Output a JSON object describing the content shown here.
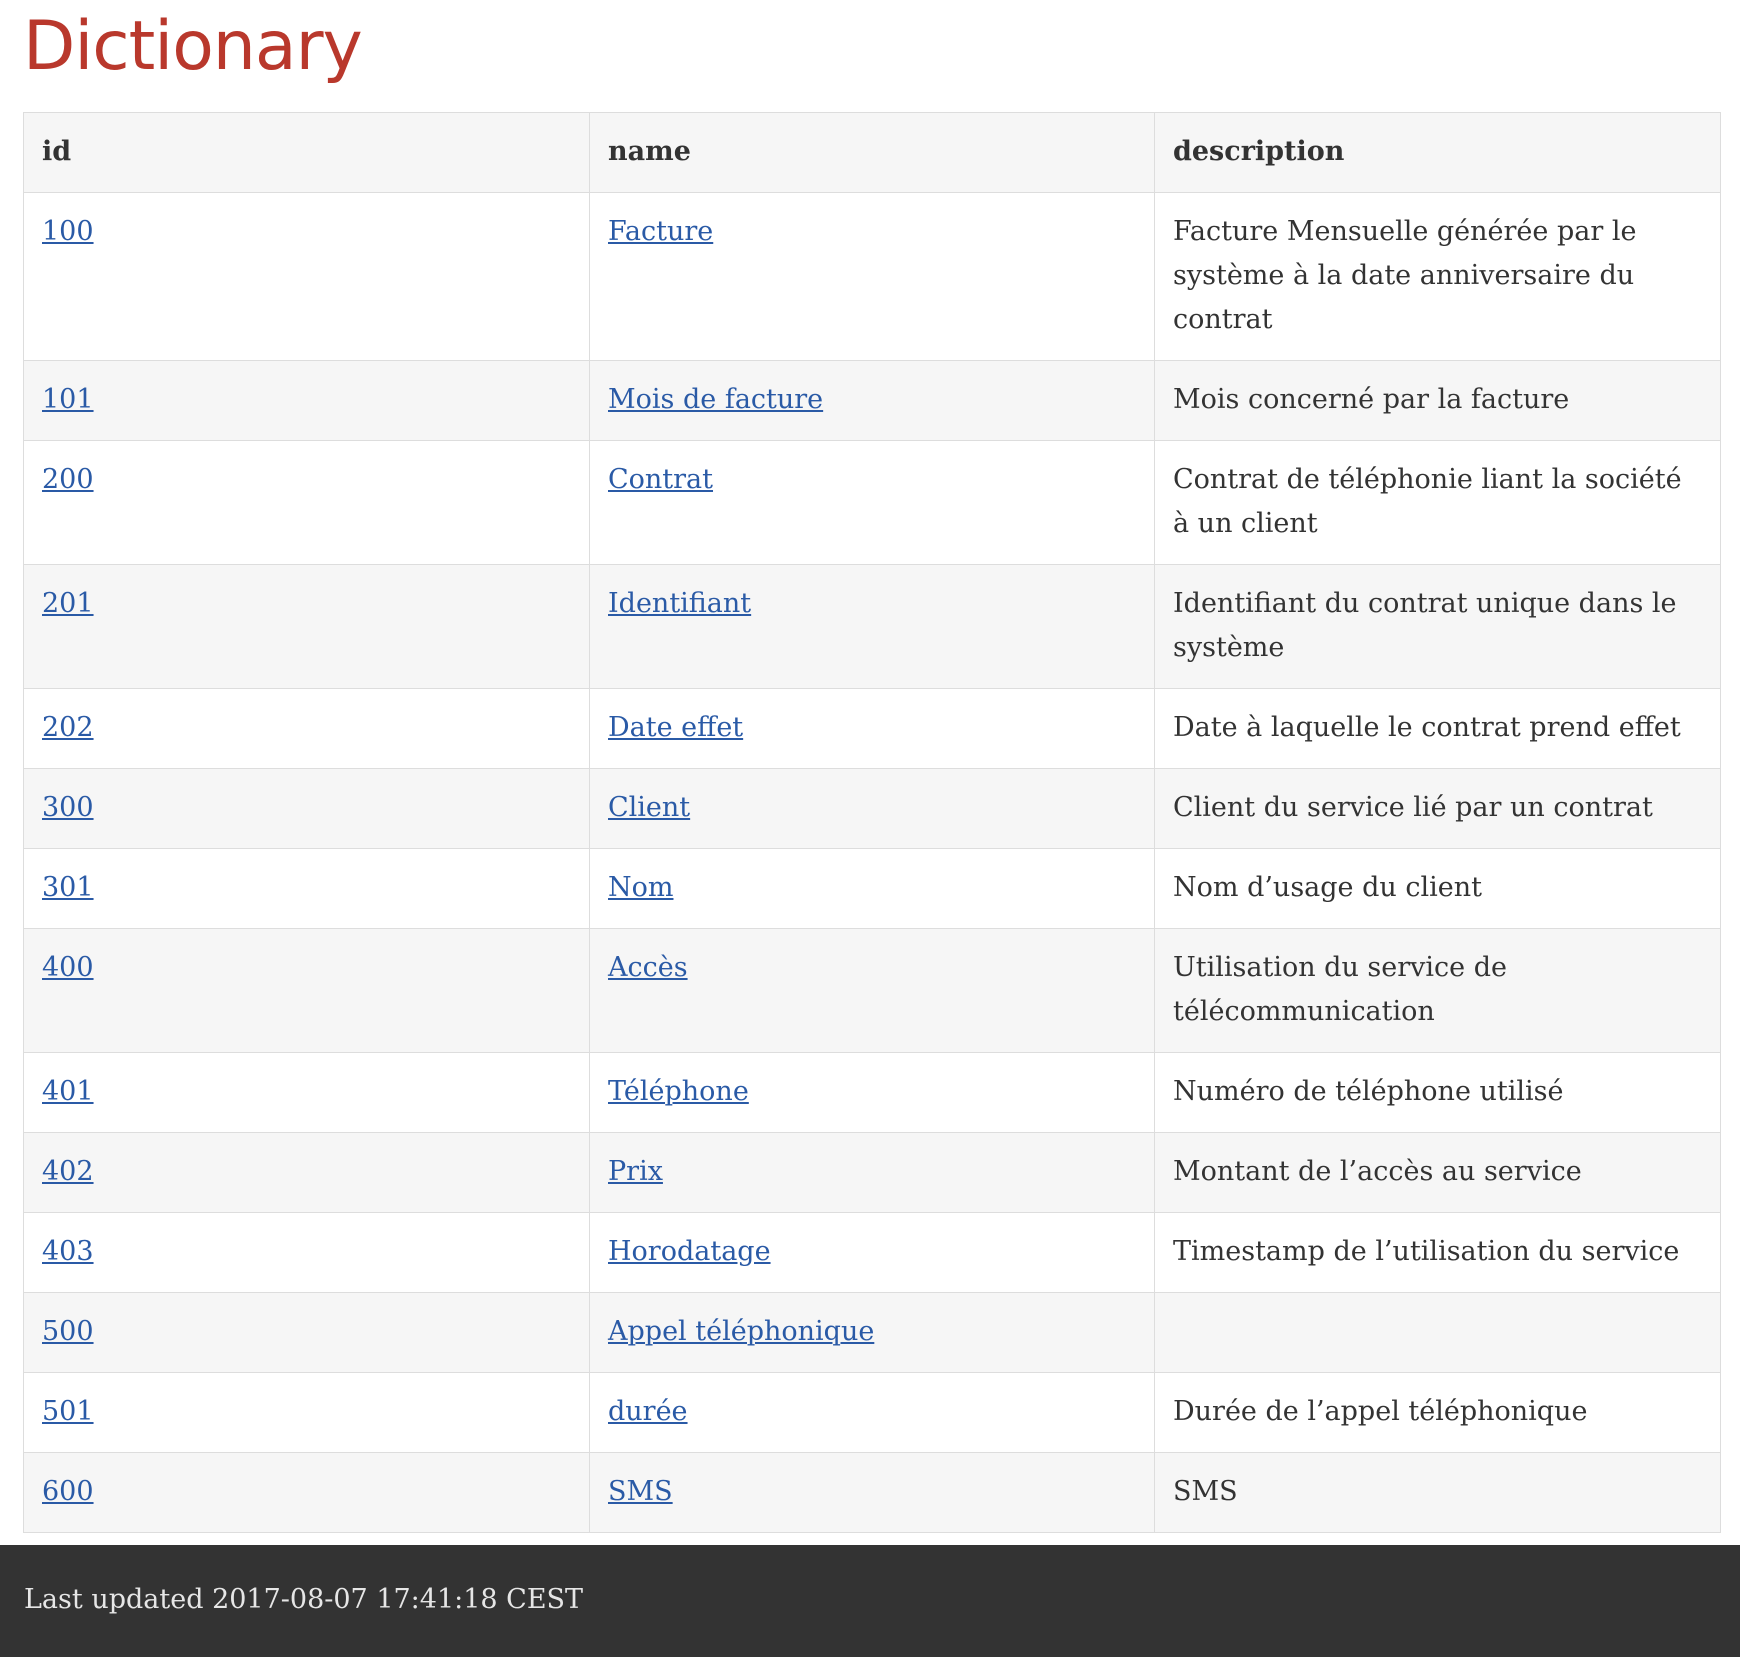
{
  "page": {
    "title": "Dictionary"
  },
  "table": {
    "headers": {
      "id": "id",
      "name": "name",
      "description": "description"
    },
    "rows": [
      {
        "id": "100",
        "name": "Facture",
        "description": "Facture Mensuelle générée par le système à la date anniversaire du contrat"
      },
      {
        "id": "101",
        "name": "Mois de facture",
        "description": "Mois concerné par la facture"
      },
      {
        "id": "200",
        "name": "Contrat",
        "description": "Contrat de téléphonie liant la société à un client"
      },
      {
        "id": "201",
        "name": "Identifiant",
        "description": "Identifiant du contrat unique dans le système"
      },
      {
        "id": "202",
        "name": "Date effet",
        "description": "Date à laquelle le contrat prend effet"
      },
      {
        "id": "300",
        "name": "Client",
        "description": "Client du service lié par un contrat"
      },
      {
        "id": "301",
        "name": "Nom",
        "description": "Nom d’usage du client"
      },
      {
        "id": "400",
        "name": "Accès",
        "description": "Utilisation du service de télécommunication"
      },
      {
        "id": "401",
        "name": "Téléphone",
        "description": "Numéro de téléphone utilisé"
      },
      {
        "id": "402",
        "name": "Prix",
        "description": "Montant de l’accès au service"
      },
      {
        "id": "403",
        "name": "Horodatage",
        "description": "Timestamp de l’utilisation du service"
      },
      {
        "id": "500",
        "name": "Appel téléphonique",
        "description": ""
      },
      {
        "id": "501",
        "name": "durée",
        "description": "Durée de l’appel téléphonique"
      },
      {
        "id": "600",
        "name": "SMS",
        "description": "SMS"
      }
    ]
  },
  "footer": {
    "last_updated": "Last updated 2017-08-07 17:41:18 CEST"
  }
}
